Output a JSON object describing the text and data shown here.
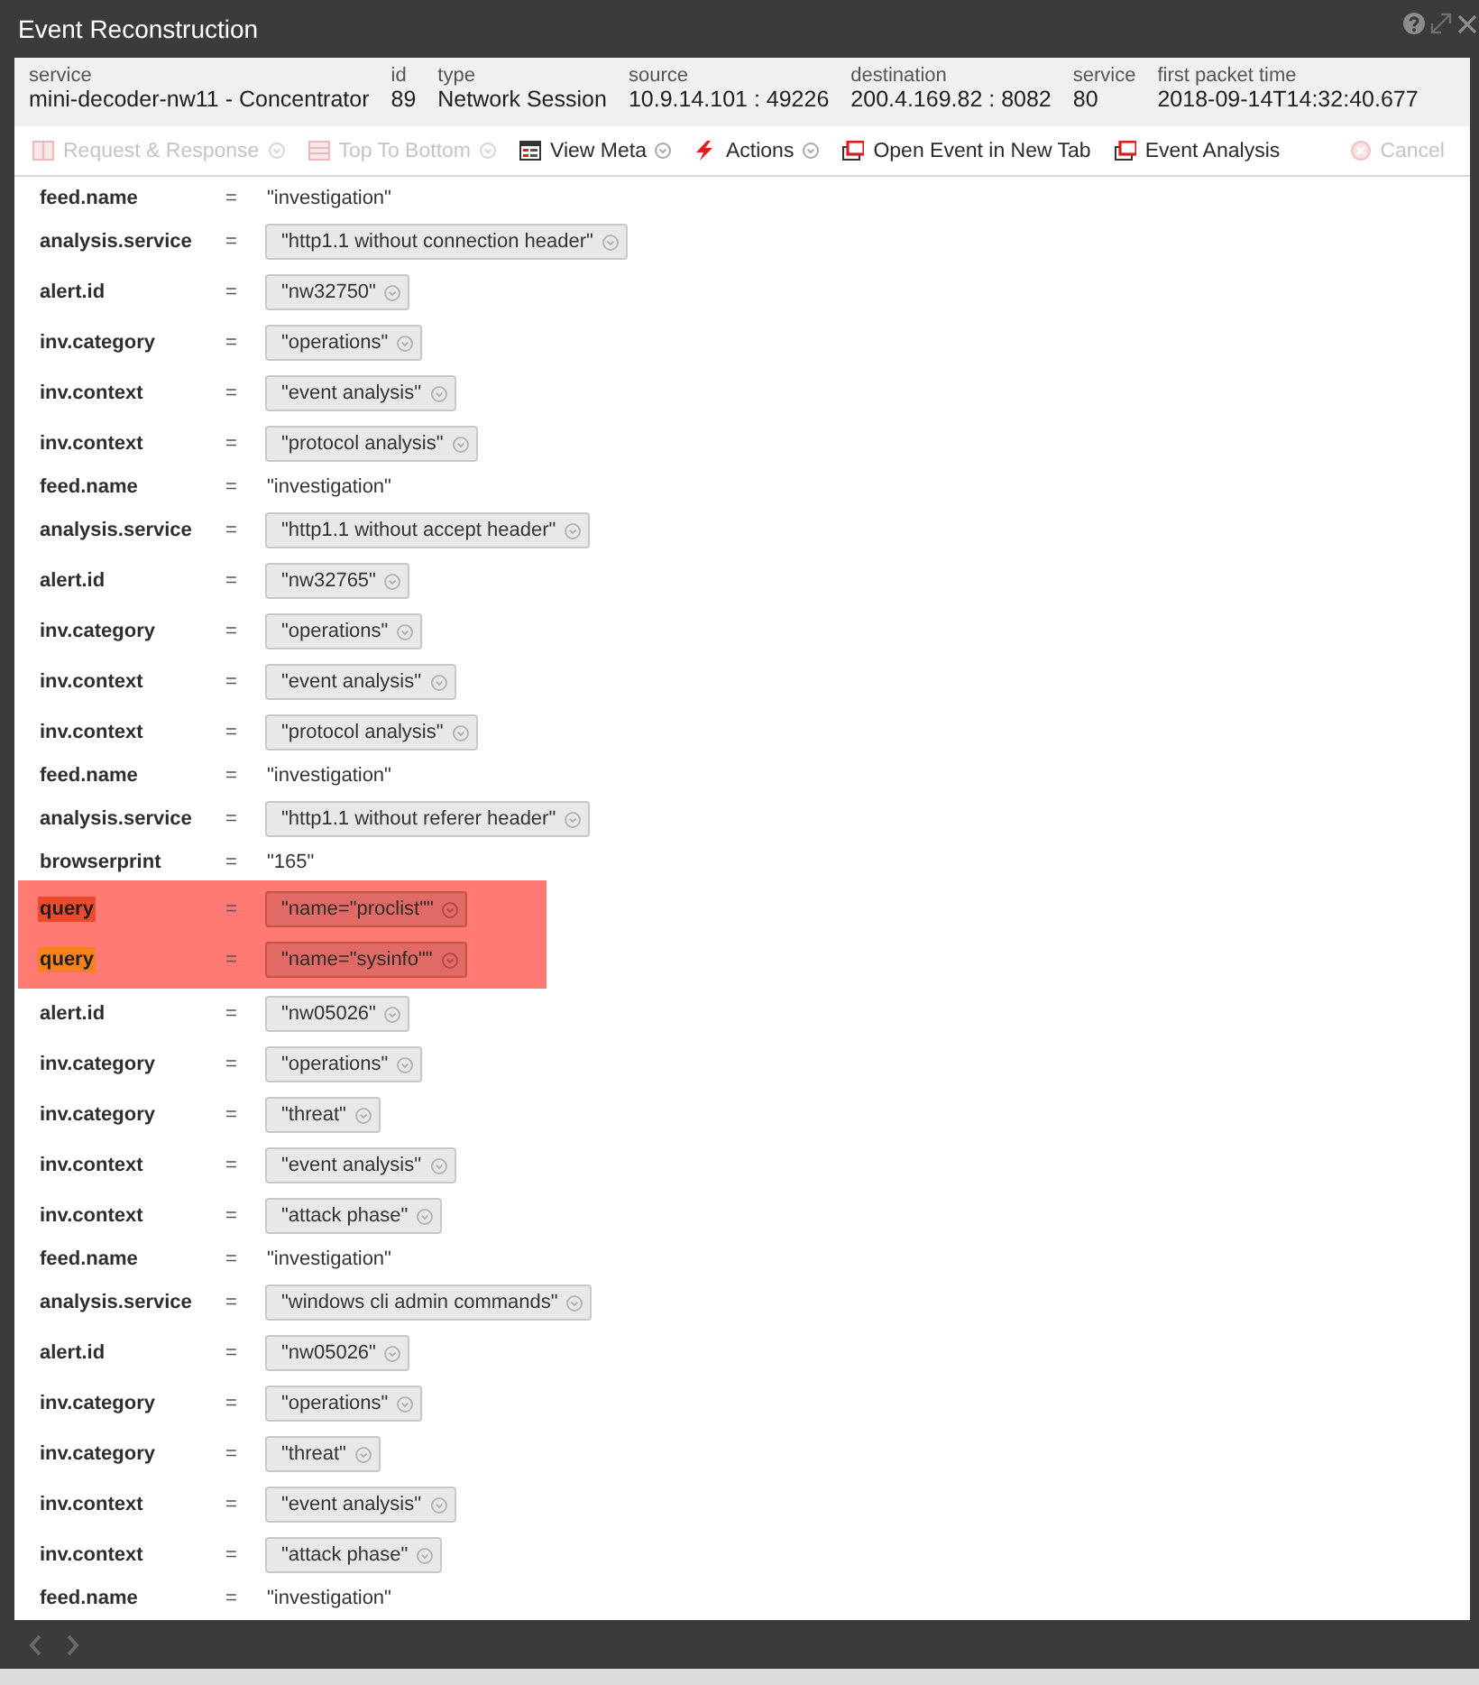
{
  "window": {
    "title": "Event Reconstruction"
  },
  "header": {
    "fields": [
      {
        "label": "service",
        "value": "mini-decoder-nw11 - Concentrator"
      },
      {
        "label": "id",
        "value": "89"
      },
      {
        "label": "type",
        "value": "Network Session"
      },
      {
        "label": "source",
        "value": "10.9.14.101 : 49226"
      },
      {
        "label": "destination",
        "value": "200.4.169.82 : 8082"
      },
      {
        "label": "service",
        "value": "80"
      },
      {
        "label": "first packet time",
        "value": "2018-09-14T14:32:40.677"
      }
    ]
  },
  "toolbar": {
    "items": [
      {
        "label": "Request & Response",
        "disabled": true,
        "has_menu": true
      },
      {
        "label": "Top To Bottom",
        "disabled": true,
        "has_menu": true
      },
      {
        "label": "View Meta",
        "disabled": false,
        "has_menu": true
      },
      {
        "label": "Actions",
        "disabled": false,
        "has_menu": true
      },
      {
        "label": "Open Event in New Tab",
        "disabled": false,
        "has_menu": false
      },
      {
        "label": "Event Analysis",
        "disabled": false,
        "has_menu": false
      }
    ],
    "cancel": {
      "label": "Cancel",
      "disabled": true
    }
  },
  "meta": {
    "entries": [
      {
        "kind": "text",
        "key": "feed.name",
        "separator": "=",
        "value": "\"investigation\""
      },
      {
        "kind": "pill",
        "key": "analysis.service",
        "separator": "=",
        "value": "\"http1.1 without connection header\""
      },
      {
        "kind": "pill",
        "key": "alert.id",
        "separator": "=",
        "value": "\"nw32750\""
      },
      {
        "kind": "pill",
        "key": "inv.category",
        "separator": "=",
        "value": "\"operations\""
      },
      {
        "kind": "pill",
        "key": "inv.context",
        "separator": "=",
        "value": "\"event analysis\""
      },
      {
        "kind": "pill",
        "key": "inv.context",
        "separator": "=",
        "value": "\"protocol analysis\""
      },
      {
        "kind": "text",
        "key": "feed.name",
        "separator": "=",
        "value": "\"investigation\""
      },
      {
        "kind": "pill",
        "key": "analysis.service",
        "separator": "=",
        "value": "\"http1.1 without accept header\""
      },
      {
        "kind": "pill",
        "key": "alert.id",
        "separator": "=",
        "value": "\"nw32765\""
      },
      {
        "kind": "pill",
        "key": "inv.category",
        "separator": "=",
        "value": "\"operations\""
      },
      {
        "kind": "pill",
        "key": "inv.context",
        "separator": "=",
        "value": "\"event analysis\""
      },
      {
        "kind": "pill",
        "key": "inv.context",
        "separator": "=",
        "value": "\"protocol analysis\""
      },
      {
        "kind": "text",
        "key": "feed.name",
        "separator": "=",
        "value": "\"investigation\""
      },
      {
        "kind": "pill",
        "key": "analysis.service",
        "separator": "=",
        "value": "\"http1.1 without referer header\""
      },
      {
        "kind": "text",
        "key": "browserprint",
        "separator": "=",
        "value": "\"165\""
      },
      {
        "kind": "highlight",
        "rows": [
          {
            "kind": "pill",
            "key": "query",
            "separator": "=",
            "value": "\"name=\"proclist\"\"",
            "color": "#ec4a2c"
          },
          {
            "kind": "pill",
            "key": "query",
            "separator": "=",
            "value": "\"name=\"sysinfo\"\"",
            "color": "#f7801f"
          }
        ]
      },
      {
        "kind": "pill",
        "key": "alert.id",
        "separator": "=",
        "value": "\"nw05026\""
      },
      {
        "kind": "pill",
        "key": "inv.category",
        "separator": "=",
        "value": "\"operations\""
      },
      {
        "kind": "pill",
        "key": "inv.category",
        "separator": "=",
        "value": "\"threat\""
      },
      {
        "kind": "pill",
        "key": "inv.context",
        "separator": "=",
        "value": "\"event analysis\""
      },
      {
        "kind": "pill",
        "key": "inv.context",
        "separator": "=",
        "value": "\"attack phase\""
      },
      {
        "kind": "text",
        "key": "feed.name",
        "separator": "=",
        "value": "\"investigation\""
      },
      {
        "kind": "pill",
        "key": "analysis.service",
        "separator": "=",
        "value": "\"windows cli admin commands\""
      },
      {
        "kind": "pill",
        "key": "alert.id",
        "separator": "=",
        "value": "\"nw05026\""
      },
      {
        "kind": "pill",
        "key": "inv.category",
        "separator": "=",
        "value": "\"operations\""
      },
      {
        "kind": "pill",
        "key": "inv.category",
        "separator": "=",
        "value": "\"threat\""
      },
      {
        "kind": "pill",
        "key": "inv.context",
        "separator": "=",
        "value": "\"event analysis\""
      },
      {
        "kind": "pill",
        "key": "inv.context",
        "separator": "=",
        "value": "\"attack phase\""
      },
      {
        "kind": "text",
        "key": "feed.name",
        "separator": "=",
        "value": "\"investigation\""
      }
    ]
  }
}
